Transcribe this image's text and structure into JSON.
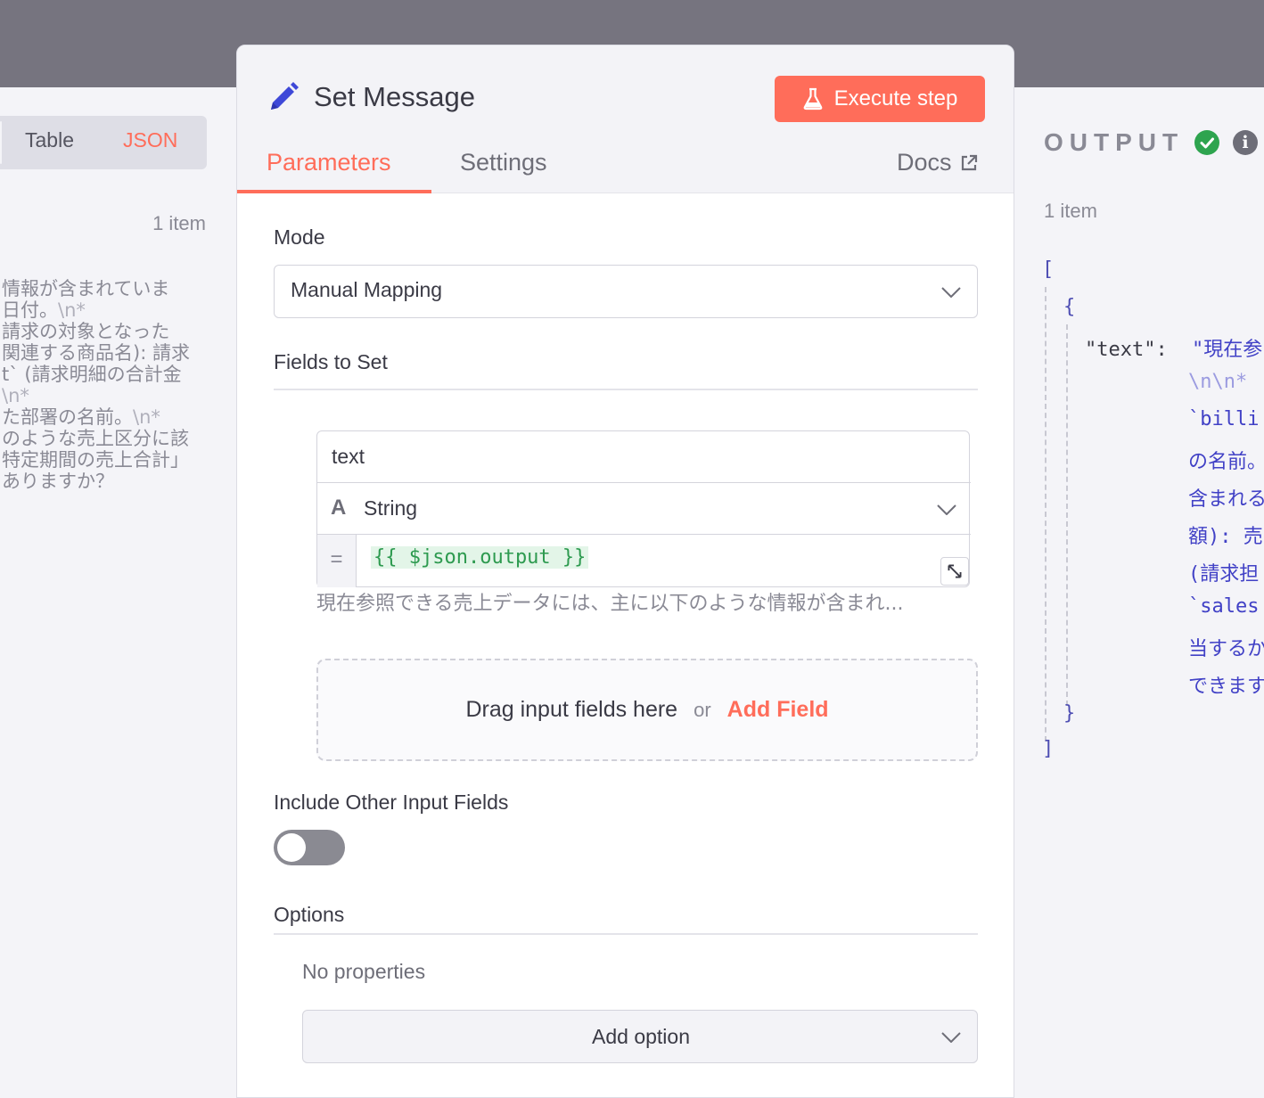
{
  "input_pane": {
    "view_tabs": [
      "Table",
      "JSON"
    ],
    "active_view": "JSON",
    "item_count": "1 item",
    "text_lines": [
      {
        "text": "情報が含まれていま",
        "esc": ""
      },
      {
        "text": "日付。",
        "esc": "\\n*"
      },
      {
        "text": "請求の対象となった",
        "esc": ""
      },
      {
        "text": "関連する商品名): 請求",
        "esc": ""
      },
      {
        "text": "t` (請求明細の合計金",
        "esc": ""
      },
      {
        "text": "",
        "esc": "\\n*"
      },
      {
        "text": "た部署の名前。",
        "esc": "\\n*"
      },
      {
        "text": "のような売上区分に該",
        "esc": ""
      },
      {
        "text": "特定期間の売上合計」",
        "esc": ""
      },
      {
        "text": "ありますか？",
        "esc": ""
      }
    ]
  },
  "modal": {
    "title": "Set Message",
    "execute_label": "Execute step",
    "tabs": {
      "parameters": "Parameters",
      "settings": "Settings",
      "docs": "Docs"
    },
    "mode_label": "Mode",
    "mode_value": "Manual Mapping",
    "fields_label": "Fields to Set",
    "field": {
      "name": "text",
      "type_icon": "A",
      "type": "String",
      "eq": "=",
      "expression": "{{ $json.output }}",
      "preview": "現在参照できる売上データには、主に以下のような情報が含まれ..."
    },
    "dropzone": {
      "text": "Drag input fields here",
      "or": "or",
      "add": "Add Field"
    },
    "include_label": "Include Other Input Fields",
    "include_enabled": false,
    "options_label": "Options",
    "no_properties": "No properties",
    "add_option": "Add option"
  },
  "output_pane": {
    "title": "OUTPUT",
    "item_count": "1 item",
    "open_bracket": "[",
    "open_brace": "{",
    "key": "\"text\":",
    "value_first": "\"現在参",
    "value_lines": [
      {
        "text": "",
        "esc": "\\n\\n*"
      },
      {
        "text": "`billi",
        "esc": ""
      },
      {
        "text": "の名前。",
        "esc": ""
      },
      {
        "text": "含まれる",
        "esc": ""
      },
      {
        "text": "額): 売",
        "esc": ""
      },
      {
        "text": "(請求担",
        "esc": ""
      },
      {
        "text": "`sales",
        "esc": ""
      },
      {
        "text": "当するか",
        "esc": ""
      },
      {
        "text": "できます",
        "esc": ""
      }
    ],
    "close_brace": "}",
    "close_bracket": "]"
  },
  "colors": {
    "accent": "#ff6d5a",
    "success": "#2ea44f",
    "json_string": "#4141c6"
  }
}
